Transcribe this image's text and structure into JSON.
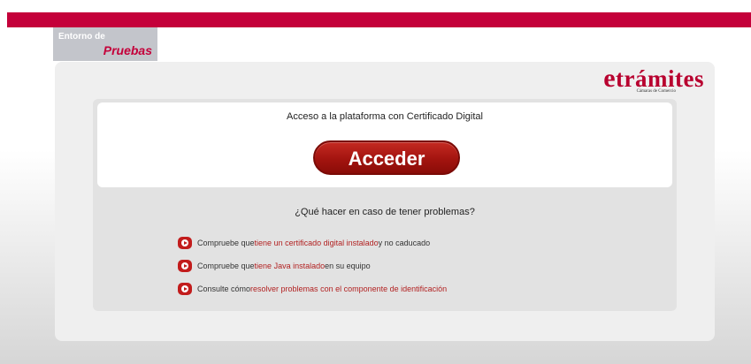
{
  "environment": {
    "line1": "Entorno de",
    "line2": "Pruebas"
  },
  "logo": {
    "e": "e",
    "name": "trámites",
    "subtitle": "Cámaras de Comercio"
  },
  "access": {
    "title": "Acceso a la plataforma con Certificado Digital",
    "button_label": "Acceder"
  },
  "problems": {
    "title": "¿Qué hacer en caso de tener problemas?",
    "items": [
      {
        "pre": "Compruebe que ",
        "link": "tiene un certificado digital instalado",
        "post": " y no caducado",
        "icon": "youtube-icon"
      },
      {
        "pre": "Compruebe que ",
        "link": "tiene Java instalado",
        "post": " en su equipo",
        "icon": "youtube-icon"
      },
      {
        "pre": "Consulte cómo ",
        "link": "resolver problemas con el componente de identificación",
        "post": "",
        "icon": "youtube-icon"
      }
    ]
  },
  "colors": {
    "brand": "#c4003a",
    "button": "#a3140f",
    "link": "#b22222"
  }
}
